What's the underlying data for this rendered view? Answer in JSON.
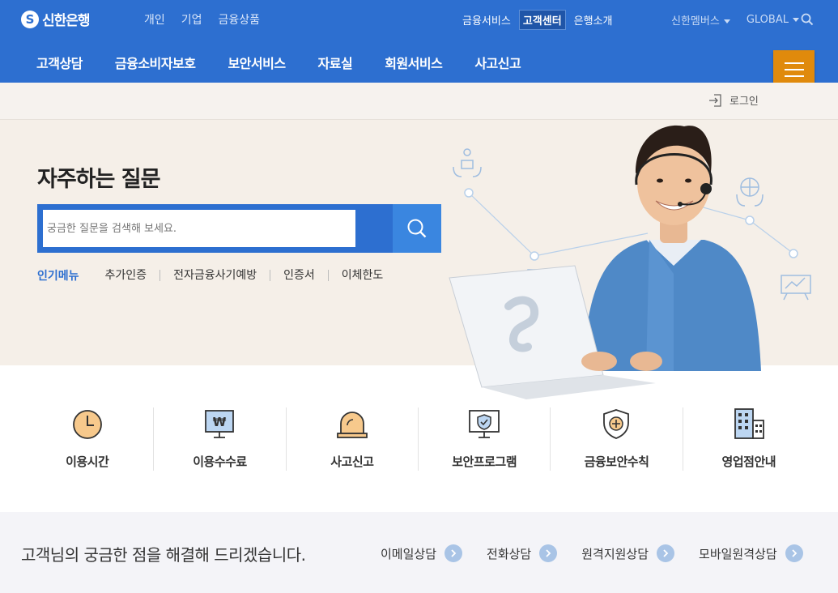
{
  "header": {
    "logo_text": "신한은행",
    "top_nav": [
      "개인",
      "기업",
      "금융상품"
    ],
    "util_nav": [
      "금융서비스",
      "고객센터",
      "은행소개"
    ],
    "util_active": "고객센터",
    "family": "신한멤버스",
    "global": "GLOBAL",
    "main_nav": [
      "고객상담",
      "금융소비자보호",
      "보안서비스",
      "자료실",
      "회원서비스",
      "사고신고"
    ],
    "menu_icon": "hamburger-icon"
  },
  "login": {
    "label": "로그인",
    "icon": "login-icon"
  },
  "hero": {
    "title": "자주하는 질문",
    "search_placeholder": "궁금한 질문을 검색해 보세요.",
    "popular_title": "인기메뉴",
    "popular_items": [
      "추가인증",
      "전자금융사기예방",
      "인증서",
      "이체한도"
    ]
  },
  "quick_menu": [
    {
      "label": "이용시간",
      "icon": "clock-icon"
    },
    {
      "label": "이용수수료",
      "icon": "won-monitor-icon"
    },
    {
      "label": "사고신고",
      "icon": "siren-icon"
    },
    {
      "label": "보안프로그램",
      "icon": "shield-monitor-icon"
    },
    {
      "label": "금융보안수칙",
      "icon": "shield-plus-icon"
    },
    {
      "label": "영업점안내",
      "icon": "building-icon"
    }
  ],
  "bottom": {
    "message": "고객님의 궁금한 점을 해결해 드리겠습니다.",
    "consult": [
      "이메일상담",
      "전화상담",
      "원격지원상담",
      "모바일원격상담"
    ]
  },
  "colors": {
    "brand_blue": "#2d6fd0",
    "accent_orange": "#e08a0c",
    "hero_bg": "#f5efe8",
    "icon_orange": "#f7c98c"
  }
}
